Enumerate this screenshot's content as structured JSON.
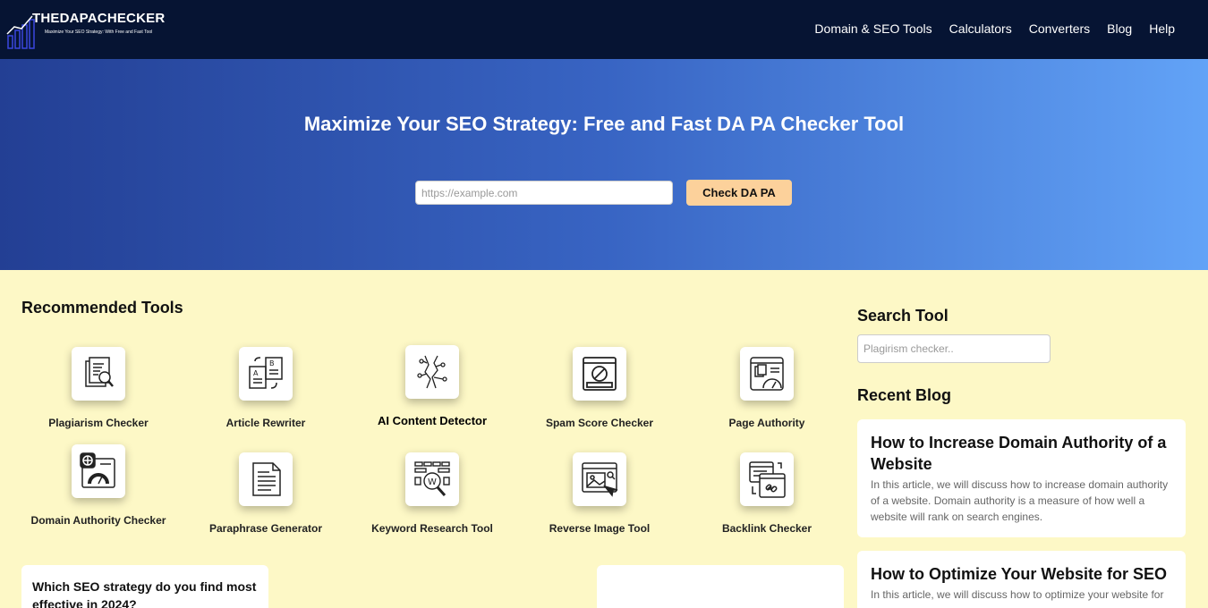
{
  "brand": {
    "name": "THEDAPACHECKER",
    "tagline": "Maximize Your SEO Strategy: With Free and Fast Tool"
  },
  "nav": {
    "items": [
      {
        "label": "Domain & SEO Tools"
      },
      {
        "label": "Calculators"
      },
      {
        "label": "Converters"
      },
      {
        "label": "Blog"
      },
      {
        "label": "Help"
      }
    ]
  },
  "hero": {
    "title": "Maximize Your SEO Strategy: Free and Fast DA PA Checker Tool",
    "input_placeholder": "https://example.com",
    "button_label": "Check DA PA"
  },
  "recommended": {
    "title": "Recommended Tools",
    "tools": [
      {
        "label": "Plagiarism Checker",
        "icon": "plagiarism-icon"
      },
      {
        "label": "Article Rewriter",
        "icon": "article-rewriter-icon"
      },
      {
        "label": "AI Content Detector",
        "icon": "ai-detector-icon"
      },
      {
        "label": "Spam Score Checker",
        "icon": "spam-score-icon"
      },
      {
        "label": "Page Authority",
        "icon": "page-authority-icon"
      },
      {
        "label": "Domain Authority Checker",
        "icon": "domain-authority-icon"
      },
      {
        "label": "Paraphrase Generator",
        "icon": "paraphrase-icon"
      },
      {
        "label": "Keyword Research Tool",
        "icon": "keyword-research-icon"
      },
      {
        "label": "Reverse Image Tool",
        "icon": "reverse-image-icon"
      },
      {
        "label": "Backlink Checker",
        "icon": "backlink-icon"
      }
    ]
  },
  "sidebar": {
    "search_title": "Search Tool",
    "search_placeholder": "Plagirism checker..",
    "recent_title": "Recent Blog",
    "posts": [
      {
        "title": "How to Increase Domain Authority of a Website",
        "excerpt": "In this article, we will discuss how to increase domain authority of a website. Domain authority is a measure of how well a website will rank on search engines."
      },
      {
        "title": "How to Optimize Your Website for SEO",
        "excerpt": "In this article, we will discuss how to optimize your website for"
      }
    ]
  },
  "poll": {
    "question": "Which SEO strategy do you find most effective in 2024?"
  },
  "colors": {
    "navbar": "#061433",
    "hero_start": "#233f94",
    "hero_end": "#62a3f7",
    "page_bg": "#fdf8c6",
    "button": "#fcd19b"
  }
}
